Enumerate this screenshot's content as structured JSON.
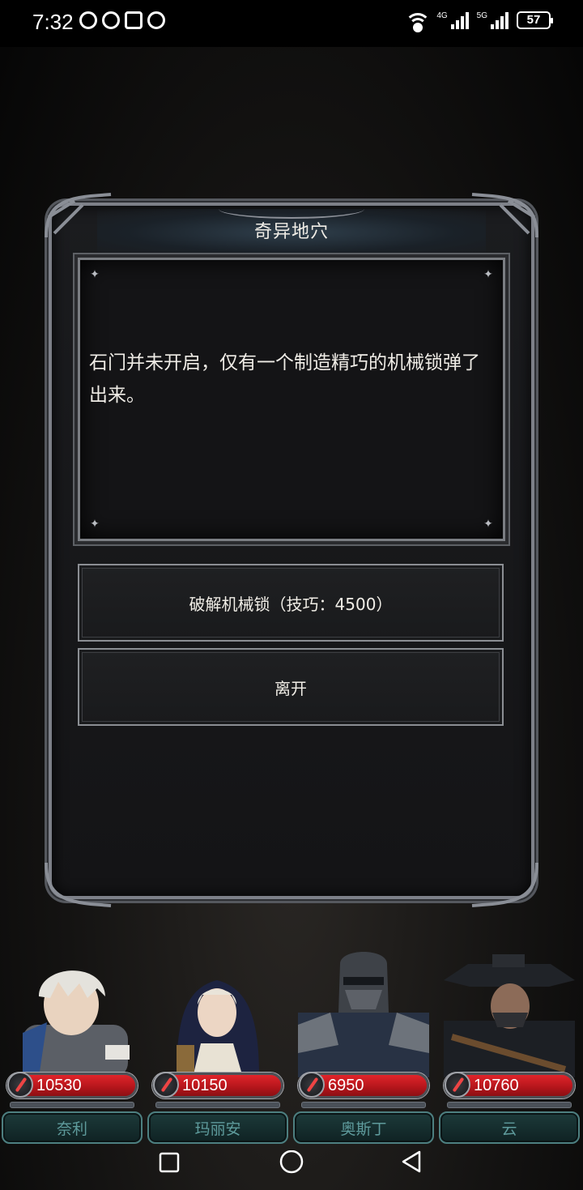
{
  "status_bar": {
    "time": "7:32",
    "left_icons": [
      "data-saver-icon",
      "speedometer-icon",
      "nfc-icon",
      "alarm-icon"
    ],
    "signal_labels": [
      "4G",
      "5G"
    ],
    "battery": "57"
  },
  "dialog": {
    "title": "奇异地穴",
    "story": "石门并未开启，仅有一个制造精巧的机械锁弹了出来。",
    "choices": [
      {
        "label": "破解机械锁（技巧：4500）"
      },
      {
        "label": "离开"
      }
    ]
  },
  "party": [
    {
      "name": "奈利",
      "hp": "10530",
      "portrait": "knight-white-hair"
    },
    {
      "name": "玛丽安",
      "hp": "10150",
      "portrait": "nun"
    },
    {
      "name": "奥斯丁",
      "hp": "6950",
      "portrait": "masked-soldier"
    },
    {
      "name": "云",
      "hp": "10760",
      "portrait": "wide-hat-swordsman"
    }
  ],
  "nav": {
    "icons": [
      "recent-apps-icon",
      "home-icon",
      "back-icon"
    ]
  },
  "colors": {
    "hp_red": "#c41a20",
    "name_teal": "#5e9b9c",
    "frame_silver": "#7d8088"
  }
}
